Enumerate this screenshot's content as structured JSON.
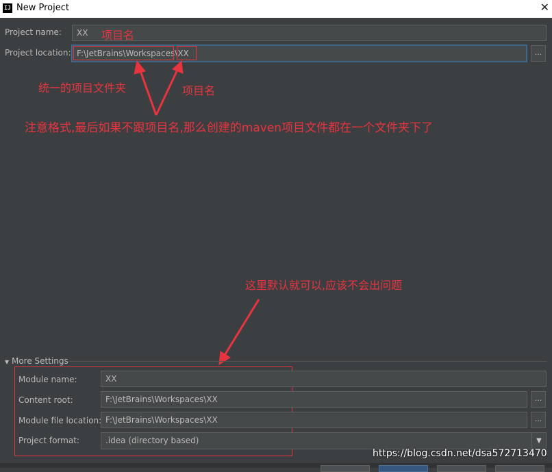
{
  "window": {
    "title": "New Project",
    "app_icon": "IJ",
    "close_glyph": "✕"
  },
  "form": {
    "project_name_label": "Project name:",
    "project_name_value": "XX",
    "project_location_label": "Project location:",
    "project_location_value": "F:\\JetBrains\\Workspaces\\XX",
    "browse_label": "..."
  },
  "annotations": {
    "name_tag": "项目名",
    "unified_folder": "统一的项目文件夹",
    "project_name_note": "项目名",
    "format_note": "注意格式,最后如果不跟项目名,那么创建的maven项目文件都在一个文件夹下了",
    "defaults_note": "这里默认就可以,应该不会出问题",
    "color": "#e8343f"
  },
  "more_settings": {
    "label": "More Settings",
    "toggle_icon": "▼",
    "module_name_label": "Module name:",
    "module_name_value": "XX",
    "content_root_label": "Content root:",
    "content_root_value": "F:\\JetBrains\\Workspaces\\XX",
    "module_file_location_label": "Module file location:",
    "module_file_location_value": "F:\\JetBrains\\Workspaces\\XX",
    "project_format_label": "Project format:",
    "project_format_value": ".idea (directory based)",
    "dropdown_icon": "▼"
  },
  "watermark": "https://blog.csdn.net/dsa572713470",
  "colors": {
    "background": "#3c3f41",
    "field_bg": "#45494a",
    "text": "#bbbbbb",
    "focus": "#466d94"
  }
}
